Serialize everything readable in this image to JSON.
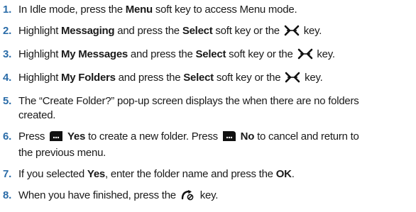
{
  "steps": [
    {
      "num": "1.",
      "parts": [
        "In Idle mode, press the ",
        "Menu",
        " soft key to access Menu mode."
      ]
    },
    {
      "num": "2.",
      "parts": [
        "Highlight ",
        "Messaging",
        " and press the ",
        "Select",
        " soft key or the ",
        " key."
      ],
      "icon": "ok-key-icon"
    },
    {
      "num": "3.",
      "parts": [
        "Highlight ",
        "My Messages",
        " and press the ",
        "Select",
        " soft key or the ",
        " key."
      ],
      "icon": "ok-key-icon"
    },
    {
      "num": "4.",
      "parts": [
        "Highlight ",
        "My Folders",
        " and press the ",
        "Select",
        " soft key or the ",
        " key."
      ],
      "icon": "ok-key-icon"
    },
    {
      "num": "5.",
      "parts": [
        "The “Create Folder?” pop-up screen displays the when there are no folders",
        "created."
      ]
    },
    {
      "num": "6.",
      "parts": [
        "Press ",
        "Yes",
        " to create a new folder. Press ",
        "No",
        " to cancel and return to",
        "the previous menu."
      ],
      "icons": [
        "left-soft-key-icon",
        "right-soft-key-icon"
      ]
    },
    {
      "num": "7.",
      "parts": [
        "If you selected ",
        "Yes",
        ", enter the folder name and press the ",
        "OK",
        "."
      ]
    },
    {
      "num": "8.",
      "parts": [
        "When you have finished, press the ",
        " key."
      ],
      "icon": "end-key-icon"
    }
  ],
  "colors": {
    "number": "#2a6ca8",
    "text": "#1a1a1a"
  }
}
